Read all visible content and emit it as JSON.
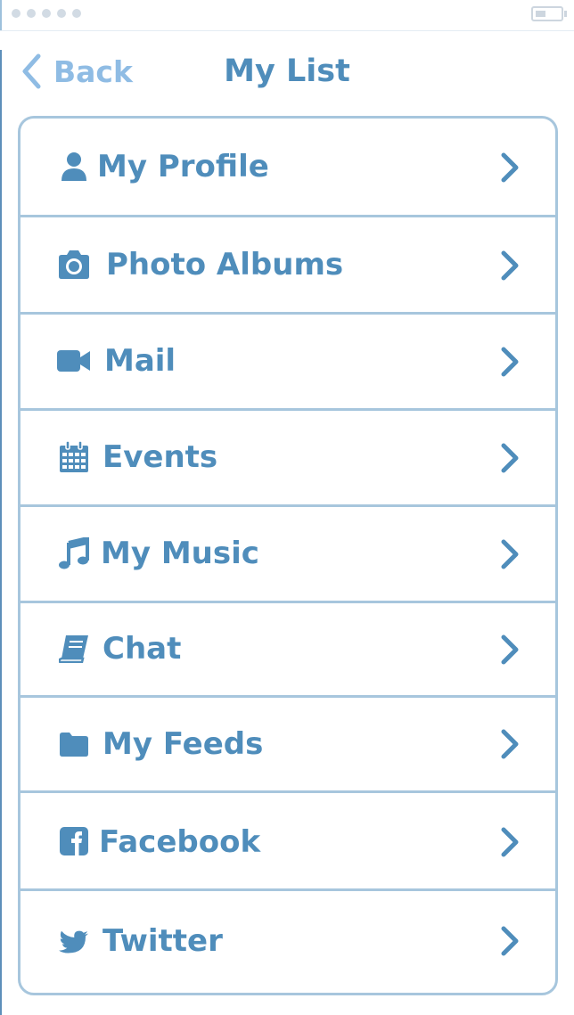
{
  "app": {
    "title": "My List",
    "back_label": "Back"
  },
  "status_bar": {
    "signal_dots": 5,
    "battery_icon": "battery-icon"
  },
  "colors": {
    "accent": "#4f8dbb",
    "back": "#8fbce4",
    "border": "#a7c6dd"
  },
  "menu": {
    "items": [
      {
        "label": "My Profile",
        "icon": "user-icon"
      },
      {
        "label": "Photo Albums",
        "icon": "camera-icon"
      },
      {
        "label": "Mail",
        "icon": "video-camera-icon"
      },
      {
        "label": "Events",
        "icon": "calendar-icon"
      },
      {
        "label": "My Music",
        "icon": "music-note-icon"
      },
      {
        "label": "Chat",
        "icon": "book-icon"
      },
      {
        "label": "My Feeds",
        "icon": "folder-icon"
      },
      {
        "label": "Facebook",
        "icon": "facebook-icon"
      },
      {
        "label": "Twitter",
        "icon": "twitter-icon"
      }
    ]
  }
}
